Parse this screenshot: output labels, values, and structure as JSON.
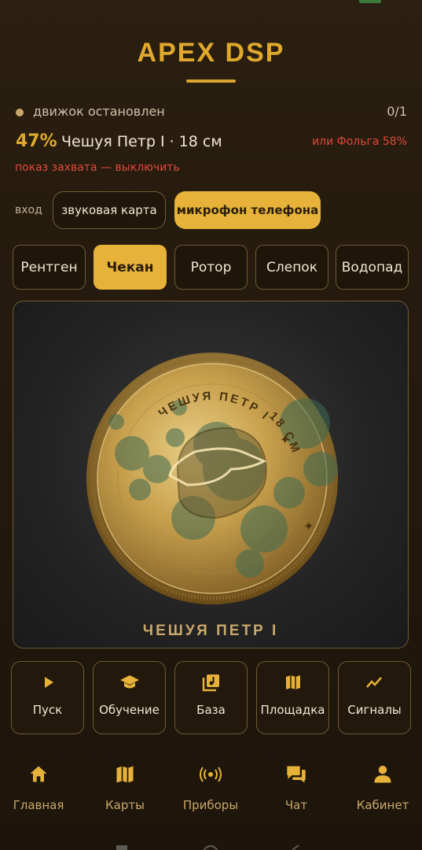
{
  "app": {
    "title": "APEX DSP"
  },
  "engine": {
    "status": "движок остановлен",
    "count": "0/1"
  },
  "detection": {
    "percent": "47%",
    "name": "Чешуя Петр I · 18 см",
    "alternative": "или Фольга 58%",
    "capture_toggle": "показ захвата — выключить"
  },
  "input": {
    "label": "вход",
    "options": [
      "звуковая карта",
      "микрофон телефона"
    ],
    "selected": "микрофон телефона"
  },
  "modes": {
    "items": [
      "Рентген",
      "Чекан",
      "Ротор",
      "Слепок",
      "Водопад"
    ],
    "selected": "Чекан"
  },
  "viewer": {
    "coin_text_top": "ЧЕШУЯ ПЕТР I",
    "coin_text_size": "18 СМ",
    "caption": "ЧЕШУЯ ПЕТР I"
  },
  "actions": [
    {
      "label": "Пуск",
      "icon": "play-icon"
    },
    {
      "label": "Обучение",
      "icon": "graduation-cap-icon"
    },
    {
      "label": "База",
      "icon": "music-library-icon"
    },
    {
      "label": "Площадка",
      "icon": "map-icon"
    },
    {
      "label": "Сигналы",
      "icon": "trend-line-icon"
    }
  ],
  "nav": [
    {
      "label": "Главная",
      "icon": "home-icon"
    },
    {
      "label": "Карты",
      "icon": "map-icon"
    },
    {
      "label": "Приборы",
      "icon": "radar-icon"
    },
    {
      "label": "Чат",
      "icon": "chat-icon"
    },
    {
      "label": "Кабинет",
      "icon": "person-icon"
    }
  ],
  "colors": {
    "accent": "#e6b23a",
    "alert": "#e0483a",
    "border": "#6e5a36"
  }
}
